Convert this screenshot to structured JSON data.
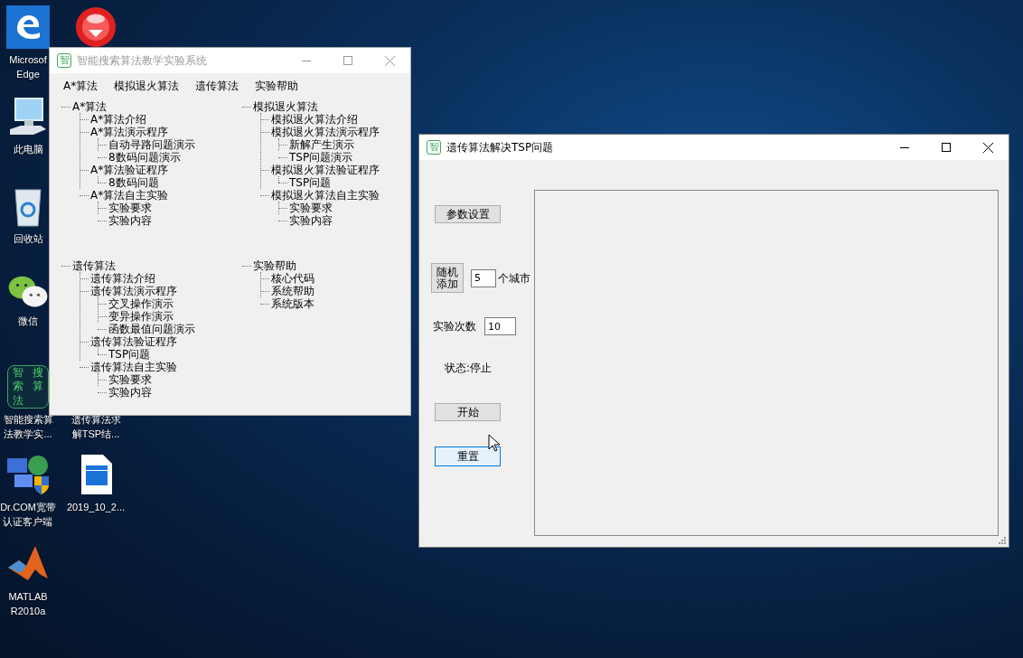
{
  "desktop": {
    "icons": [
      {
        "kind": "edge",
        "label": [
          "Microsof",
          "Edge"
        ]
      },
      {
        "kind": "red-ball"
      },
      {
        "kind": "computer",
        "label": [
          "此电脑"
        ]
      },
      {
        "kind": "recycle-bin",
        "label": [
          "回收站"
        ]
      },
      {
        "kind": "chat",
        "label": [
          "微信"
        ]
      },
      {
        "kind": "app-tile",
        "glyphs": "智搜索算法",
        "label": [
          "智能搜索算",
          "法教学实..."
        ]
      },
      {
        "label": [
          "遗传算法求",
          "解TSP结..."
        ]
      },
      {
        "kind": "network",
        "label": [
          "Dr.COM宽带",
          "认证客户端"
        ]
      },
      {
        "kind": "video-file",
        "label": [
          "2019_10_2..."
        ]
      },
      {
        "kind": "matlab",
        "label": [
          "MATLAB",
          "R2010a"
        ]
      }
    ]
  },
  "main_window": {
    "title": "智能搜索算法教学实验系统",
    "icon_glyph": "智",
    "active": false,
    "menu": [
      "A*算法",
      "模拟退火算法",
      "遗传算法",
      "实验帮助"
    ],
    "trees": [
      {
        "label": "A*算法",
        "children": [
          {
            "label": "A*算法介绍"
          },
          {
            "label": "A*算法演示程序",
            "children": [
              {
                "label": "自动寻路问题演示"
              },
              {
                "label": "8数码问题演示"
              }
            ]
          },
          {
            "label": "A*算法验证程序",
            "children": [
              {
                "label": "8数码问题"
              }
            ]
          },
          {
            "label": "A*算法自主实验",
            "children": [
              {
                "label": "实验要求"
              },
              {
                "label": "实验内容"
              }
            ]
          }
        ]
      },
      {
        "label": "模拟退火算法",
        "children": [
          {
            "label": "模拟退火算法介绍"
          },
          {
            "label": "模拟退火算法演示程序",
            "children": [
              {
                "label": "新解产生演示"
              },
              {
                "label": "TSP问题演示"
              }
            ]
          },
          {
            "label": "模拟退火算法验证程序",
            "children": [
              {
                "label": "TSP问题"
              }
            ]
          },
          {
            "label": "模拟退火算法自主实验",
            "children": [
              {
                "label": "实验要求"
              },
              {
                "label": "实验内容"
              }
            ]
          }
        ]
      },
      {
        "label": "遗传算法",
        "children": [
          {
            "label": "遗传算法介绍"
          },
          {
            "label": "遗传算法演示程序",
            "children": [
              {
                "label": "交叉操作演示"
              },
              {
                "label": "变异操作演示"
              },
              {
                "label": "函数最值问题演示"
              }
            ]
          },
          {
            "label": "遗传算法验证程序",
            "children": [
              {
                "label": "TSP问题"
              }
            ]
          },
          {
            "label": "遗传算法自主实验",
            "children": [
              {
                "label": "实验要求"
              },
              {
                "label": "实验内容"
              }
            ]
          }
        ]
      },
      {
        "label": "实验帮助",
        "children": [
          {
            "label": "核心代码"
          },
          {
            "label": "系统帮助"
          },
          {
            "label": "系统版本"
          }
        ]
      }
    ]
  },
  "tsp_window": {
    "title": "遗传算法解决TSP问题",
    "icon_glyph": "智",
    "active": true,
    "controls": [
      {
        "kind": "button",
        "label": "参数设置",
        "focused": false
      },
      {
        "kind": "spin-row",
        "button": "随机添加",
        "value": "5",
        "suffix": "个城市"
      },
      {
        "kind": "field-row",
        "label": "实验次数",
        "value": "10"
      },
      {
        "kind": "status",
        "text": "状态:停止"
      },
      {
        "kind": "button",
        "label": "开始",
        "focused": false
      },
      {
        "kind": "button",
        "label": "重置",
        "focused": true
      }
    ]
  }
}
